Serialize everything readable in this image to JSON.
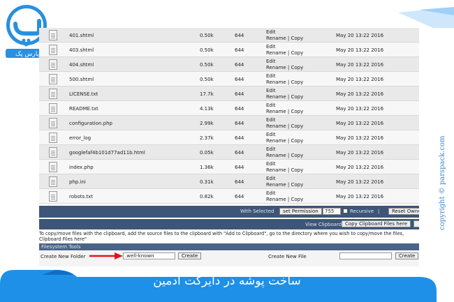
{
  "brand": {
    "name": "پارس پک",
    "copyright": "copyright © parspack.com"
  },
  "banner": {
    "title": "ساخت پوشه در دایرکت ادمین"
  },
  "files": [
    {
      "name": "401.shtml",
      "size": "0.50k",
      "perm": "644",
      "edit": "Edit",
      "rename_copy": "Rename | Copy",
      "date": "May 20 13:22 2016"
    },
    {
      "name": "403.shtml",
      "size": "0.50k",
      "perm": "644",
      "edit": "Edit",
      "rename_copy": "Rename | Copy",
      "date": "May 20 13:22 2016"
    },
    {
      "name": "404.shtml",
      "size": "0.50k",
      "perm": "644",
      "edit": "Edit",
      "rename_copy": "Rename | Copy",
      "date": "May 20 13:22 2016"
    },
    {
      "name": "500.shtml",
      "size": "0.50k",
      "perm": "644",
      "edit": "Edit",
      "rename_copy": "Rename | Copy",
      "date": "May 20 13:22 2016"
    },
    {
      "name": "LICENSE.txt",
      "size": "17.7k",
      "perm": "644",
      "edit": "Edit",
      "rename_copy": "Rename | Copy",
      "date": "May 20 13:22 2016"
    },
    {
      "name": "README.txt",
      "size": "4.13k",
      "perm": "644",
      "edit": "Edit",
      "rename_copy": "Rename | Copy",
      "date": "May 20 13:22 2016"
    },
    {
      "name": "configuration.php",
      "size": "2.99k",
      "perm": "644",
      "edit": "Edit",
      "rename_copy": "Rename | Copy",
      "date": "May 20 13:22 2016"
    },
    {
      "name": "error_log",
      "size": "2.37k",
      "perm": "644",
      "edit": "Edit",
      "rename_copy": "Rename | Copy",
      "date": "May 20 13:22 2016"
    },
    {
      "name": "googlefaf4b101d77ad11b.html",
      "size": "0.05k",
      "perm": "644",
      "edit": "Edit",
      "rename_copy": "Rename | Copy",
      "date": "May 20 13:22 2016"
    },
    {
      "name": "index.php",
      "size": "1.36k",
      "perm": "644",
      "edit": "Edit",
      "rename_copy": "Rename | Copy",
      "date": "May 20 13:22 2016"
    },
    {
      "name": "php.ini",
      "size": "0.31k",
      "perm": "644",
      "edit": "Edit",
      "rename_copy": "Rename | Copy",
      "date": "May 20 13:22 2016"
    },
    {
      "name": "robots.txt",
      "size": "0.82k",
      "perm": "644",
      "edit": "Edit",
      "rename_copy": "Rename | Copy",
      "date": "May 20 13:22 2016"
    }
  ],
  "selected_bar": {
    "label": "With Selected",
    "set_permission": "set Permission",
    "permission_value": "755",
    "recursive": "Recursive",
    "separator": "|",
    "reset_owner": "Reset Owne"
  },
  "clipboard_bar": {
    "view": "View Clipboard",
    "copy_here": "Copy Clipboard Files here"
  },
  "help_text": "To copy/move files with the clipboard, add the source files to the clipboard with \"Add to Clipboard\", go to the directory where you wish to copy/move the files,",
  "help_text_2": "Clipboard Files here\"",
  "tools": {
    "header": "Filesystem Tools",
    "new_folder_label": "Create New Folder",
    "new_folder_value": ".well-known",
    "create_label": "Create",
    "new_file_label": "Create New File",
    "new_file_value": ""
  },
  "colors": {
    "accent": "#1e90e8",
    "bar": "#3d5578",
    "arrow": "#e0141b"
  }
}
